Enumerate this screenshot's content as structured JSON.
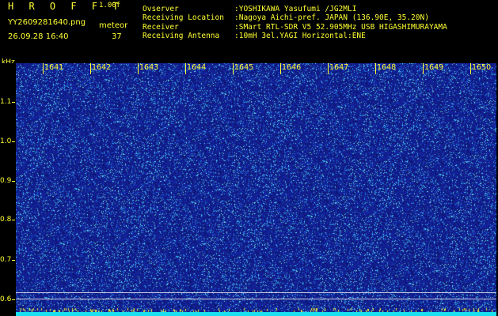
{
  "header": {
    "logo": "H R O F F T",
    "version": "1.00f",
    "filename": "YY2609281640.png",
    "mode_label": "meteor",
    "datetime": "26.09.28 16:40",
    "meteor_count": "37",
    "info": [
      {
        "label": "Ovserver",
        "value": ":YOSHIKAWA Yasufumi /JG2MLI"
      },
      {
        "label": "Receiving Location",
        "value": ":Nagoya Aichi-pref. JAPAN (136.90E, 35.20N)"
      },
      {
        "label": "Receiver",
        "value": ":SMart RTL-SDR V5 52.905MHz USB HIGASHIMURAYAMA"
      },
      {
        "label": "Receiving Antenna",
        "value": ":10mH 3el.YAGI Horizontal:ENE"
      }
    ]
  },
  "axis": {
    "y_unit": "kHz",
    "y_ticks": [
      "1.1",
      "1.0",
      "0.9",
      "0.8",
      "0.7",
      "0.6"
    ],
    "x_ticks": [
      "1641",
      "1642",
      "1643",
      "1644",
      "1645",
      "1646",
      "1647",
      "1648",
      "1649",
      "1650"
    ]
  },
  "colors": {
    "text": "#ffff33",
    "background": "#1a2d9c",
    "reference_line": "#c9cbe0",
    "floor": "#18e0f0"
  }
}
